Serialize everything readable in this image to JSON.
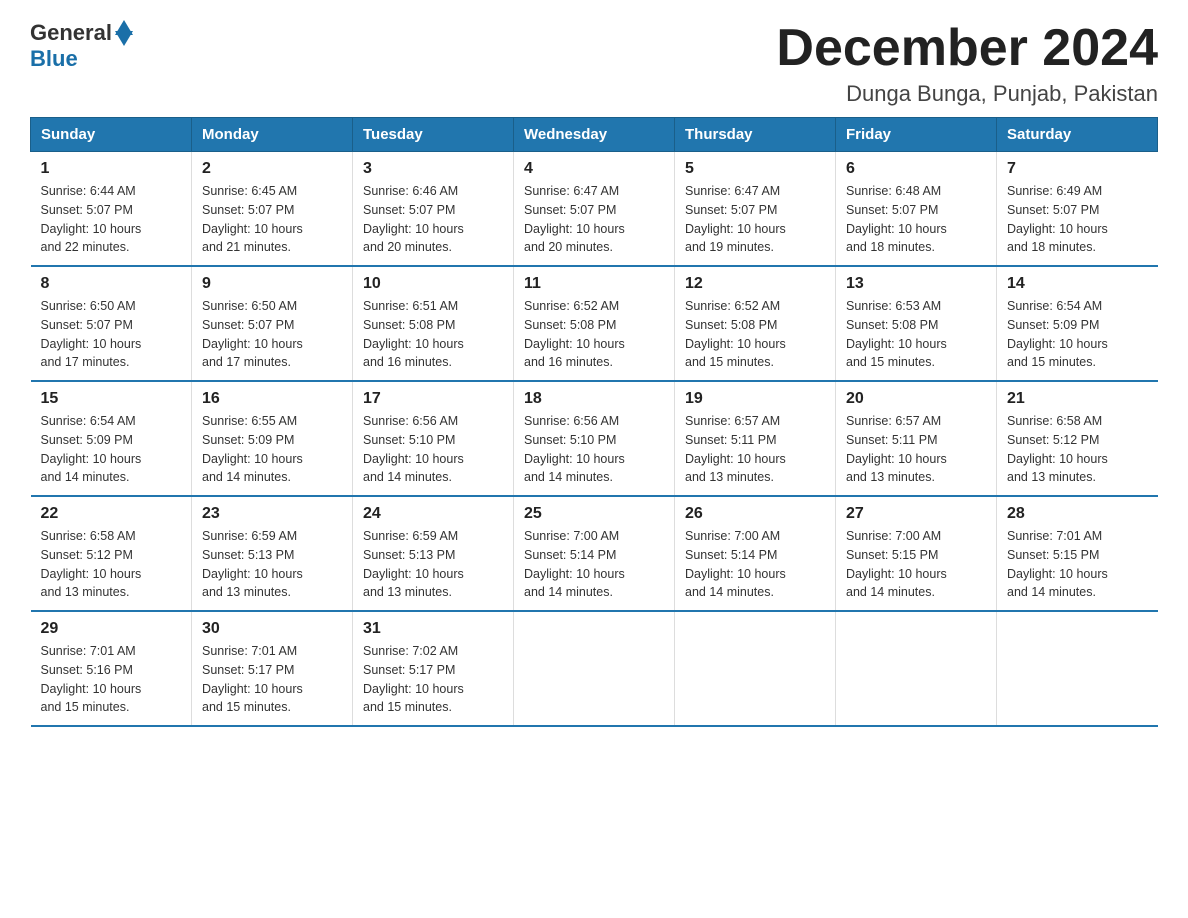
{
  "logo": {
    "general": "General",
    "blue": "Blue"
  },
  "title": "December 2024",
  "location": "Dunga Bunga, Punjab, Pakistan",
  "days_header": [
    "Sunday",
    "Monday",
    "Tuesday",
    "Wednesday",
    "Thursday",
    "Friday",
    "Saturday"
  ],
  "weeks": [
    [
      {
        "day": "1",
        "sunrise": "6:44 AM",
        "sunset": "5:07 PM",
        "daylight": "10 hours and 22 minutes."
      },
      {
        "day": "2",
        "sunrise": "6:45 AM",
        "sunset": "5:07 PM",
        "daylight": "10 hours and 21 minutes."
      },
      {
        "day": "3",
        "sunrise": "6:46 AM",
        "sunset": "5:07 PM",
        "daylight": "10 hours and 20 minutes."
      },
      {
        "day": "4",
        "sunrise": "6:47 AM",
        "sunset": "5:07 PM",
        "daylight": "10 hours and 20 minutes."
      },
      {
        "day": "5",
        "sunrise": "6:47 AM",
        "sunset": "5:07 PM",
        "daylight": "10 hours and 19 minutes."
      },
      {
        "day": "6",
        "sunrise": "6:48 AM",
        "sunset": "5:07 PM",
        "daylight": "10 hours and 18 minutes."
      },
      {
        "day": "7",
        "sunrise": "6:49 AM",
        "sunset": "5:07 PM",
        "daylight": "10 hours and 18 minutes."
      }
    ],
    [
      {
        "day": "8",
        "sunrise": "6:50 AM",
        "sunset": "5:07 PM",
        "daylight": "10 hours and 17 minutes."
      },
      {
        "day": "9",
        "sunrise": "6:50 AM",
        "sunset": "5:07 PM",
        "daylight": "10 hours and 17 minutes."
      },
      {
        "day": "10",
        "sunrise": "6:51 AM",
        "sunset": "5:08 PM",
        "daylight": "10 hours and 16 minutes."
      },
      {
        "day": "11",
        "sunrise": "6:52 AM",
        "sunset": "5:08 PM",
        "daylight": "10 hours and 16 minutes."
      },
      {
        "day": "12",
        "sunrise": "6:52 AM",
        "sunset": "5:08 PM",
        "daylight": "10 hours and 15 minutes."
      },
      {
        "day": "13",
        "sunrise": "6:53 AM",
        "sunset": "5:08 PM",
        "daylight": "10 hours and 15 minutes."
      },
      {
        "day": "14",
        "sunrise": "6:54 AM",
        "sunset": "5:09 PM",
        "daylight": "10 hours and 15 minutes."
      }
    ],
    [
      {
        "day": "15",
        "sunrise": "6:54 AM",
        "sunset": "5:09 PM",
        "daylight": "10 hours and 14 minutes."
      },
      {
        "day": "16",
        "sunrise": "6:55 AM",
        "sunset": "5:09 PM",
        "daylight": "10 hours and 14 minutes."
      },
      {
        "day": "17",
        "sunrise": "6:56 AM",
        "sunset": "5:10 PM",
        "daylight": "10 hours and 14 minutes."
      },
      {
        "day": "18",
        "sunrise": "6:56 AM",
        "sunset": "5:10 PM",
        "daylight": "10 hours and 14 minutes."
      },
      {
        "day": "19",
        "sunrise": "6:57 AM",
        "sunset": "5:11 PM",
        "daylight": "10 hours and 13 minutes."
      },
      {
        "day": "20",
        "sunrise": "6:57 AM",
        "sunset": "5:11 PM",
        "daylight": "10 hours and 13 minutes."
      },
      {
        "day": "21",
        "sunrise": "6:58 AM",
        "sunset": "5:12 PM",
        "daylight": "10 hours and 13 minutes."
      }
    ],
    [
      {
        "day": "22",
        "sunrise": "6:58 AM",
        "sunset": "5:12 PM",
        "daylight": "10 hours and 13 minutes."
      },
      {
        "day": "23",
        "sunrise": "6:59 AM",
        "sunset": "5:13 PM",
        "daylight": "10 hours and 13 minutes."
      },
      {
        "day": "24",
        "sunrise": "6:59 AM",
        "sunset": "5:13 PM",
        "daylight": "10 hours and 13 minutes."
      },
      {
        "day": "25",
        "sunrise": "7:00 AM",
        "sunset": "5:14 PM",
        "daylight": "10 hours and 14 minutes."
      },
      {
        "day": "26",
        "sunrise": "7:00 AM",
        "sunset": "5:14 PM",
        "daylight": "10 hours and 14 minutes."
      },
      {
        "day": "27",
        "sunrise": "7:00 AM",
        "sunset": "5:15 PM",
        "daylight": "10 hours and 14 minutes."
      },
      {
        "day": "28",
        "sunrise": "7:01 AM",
        "sunset": "5:15 PM",
        "daylight": "10 hours and 14 minutes."
      }
    ],
    [
      {
        "day": "29",
        "sunrise": "7:01 AM",
        "sunset": "5:16 PM",
        "daylight": "10 hours and 15 minutes."
      },
      {
        "day": "30",
        "sunrise": "7:01 AM",
        "sunset": "5:17 PM",
        "daylight": "10 hours and 15 minutes."
      },
      {
        "day": "31",
        "sunrise": "7:02 AM",
        "sunset": "5:17 PM",
        "daylight": "10 hours and 15 minutes."
      },
      null,
      null,
      null,
      null
    ]
  ],
  "sunrise_label": "Sunrise:",
  "sunset_label": "Sunset:",
  "daylight_label": "Daylight:"
}
